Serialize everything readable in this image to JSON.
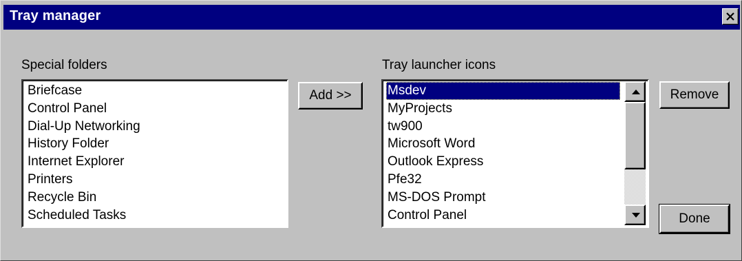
{
  "window": {
    "title": "Tray manager"
  },
  "special_folders": {
    "label": "Special folders",
    "items": [
      "Briefcase",
      "Control Panel",
      "Dial-Up Networking",
      "History Folder",
      "Internet Explorer",
      "Printers",
      "Recycle Bin",
      "Scheduled Tasks"
    ]
  },
  "tray_icons": {
    "label": "Tray launcher icons",
    "selected": "Msdev",
    "items": [
      "Msdev",
      "MyProjects",
      "tw900",
      "Microsoft Word",
      "Outlook Express",
      "Pfe32",
      "MS-DOS Prompt",
      "Control Panel"
    ]
  },
  "buttons": {
    "add": "Add >>",
    "remove": "Remove",
    "done": "Done"
  },
  "icons": {
    "close": "close-icon",
    "scroll_up": "arrow-up-icon",
    "scroll_down": "arrow-down-icon"
  },
  "colors": {
    "titlebar": "#000080",
    "face": "#c0c0c0",
    "selection": "#000080"
  }
}
